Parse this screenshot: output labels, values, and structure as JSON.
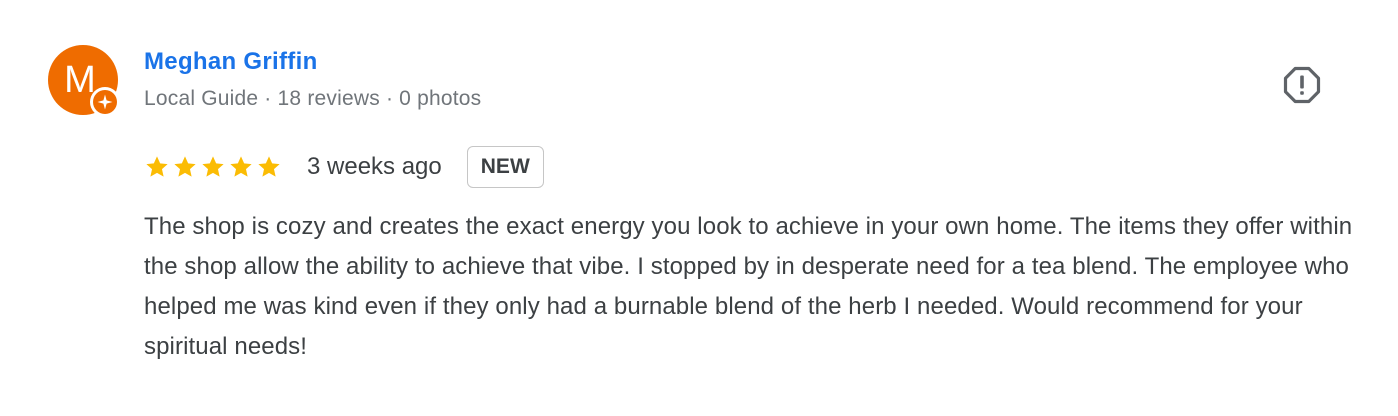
{
  "reviewer": {
    "avatar_letter": "M",
    "avatar_color": "#ef6c00",
    "name": "Meghan Griffin",
    "name_color": "#1a73e8",
    "meta": "Local Guide · 18 reviews · 0 photos",
    "badge_icon": "local-guide-star-icon"
  },
  "review": {
    "rating": 5,
    "rating_max": 5,
    "star_color": "#fbbc04",
    "time_ago": "3 weeks ago",
    "badge": "NEW",
    "text": "The shop is cozy and creates the exact energy you look to achieve in your own home. The items they offer within the shop allow the ability to achieve that vibe. I stopped by in desperate need for a tea blend. The employee who helped me was kind even if they only had a burnable blend of the herb I needed. Would recommend for your spiritual needs!"
  },
  "actions": {
    "report_icon": "report-icon"
  }
}
